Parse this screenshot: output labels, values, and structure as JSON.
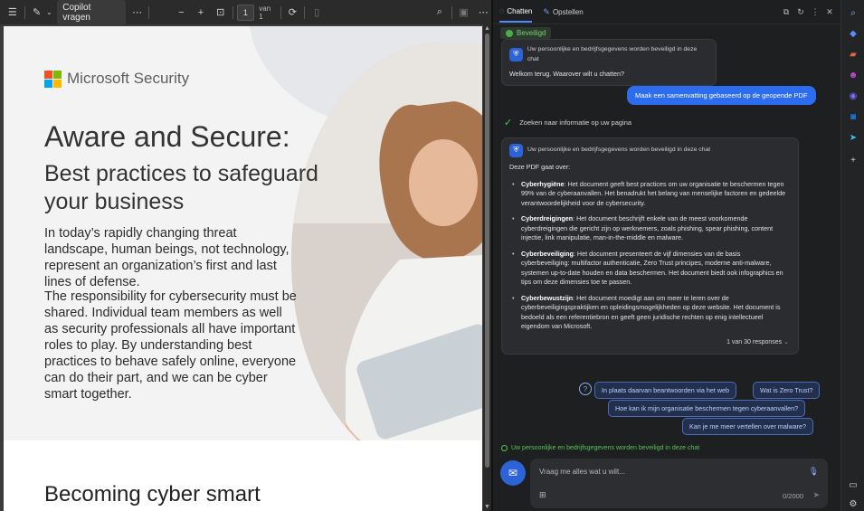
{
  "pdf_toolbar": {
    "copilot_label": "Copilot vragen",
    "page_value": "1",
    "page_of": "van 1",
    "icons": [
      "list-icon",
      "draw-icon",
      "chevron-down-icon",
      "more-icon",
      "zoom-out-icon",
      "zoom-in-icon",
      "fit-page-icon",
      "rotate-icon",
      "two-page-icon",
      "search-icon",
      "save-icon",
      "more-icon"
    ]
  },
  "pdf_page": {
    "logo_text": "Microsoft Security",
    "logo_colors": [
      "#f25022",
      "#7fba00",
      "#00a4ef",
      "#ffb900"
    ],
    "title": "Aware and Secure:",
    "subtitle": "Best practices to safeguard your business",
    "paragraph1": "In today’s rapidly changing threat landscape, human beings, not technology, represent an organization’s first and last lines of defense.",
    "paragraph2": "The responsibility for cybersecurity must be shared. Individual team members as well as security professionals all have important roles to play. By understanding best practices to behave safely online, everyone can do their part, and we can be cyber smart together.",
    "section_heading": "Becoming cyber smart"
  },
  "copilot": {
    "tabs": [
      {
        "label": "Chatten",
        "icon": "chat-icon",
        "active": true
      },
      {
        "label": "Opstellen",
        "icon": "compose-icon",
        "active": false
      }
    ],
    "header_icons": [
      "open-new-icon",
      "refresh-icon",
      "more-icon",
      "close-icon"
    ],
    "protected_badge": "Beveiligd",
    "welcome_badge": "Uw persoonlijke en bedrijfsgegevens worden beveiligd in deze chat",
    "welcome_text": "Welkom terug. Waarover wilt u chatten?",
    "user_message": "Maak een samenvatting gebaseerd op de geopende PDF",
    "searching_text": "Zoeken naar informatie op uw pagina",
    "answer_badge": "Uw persoonlijke en bedrijfsgegevens worden beveiligd in deze chat",
    "answer_intro": "Deze PDF gaat over:",
    "answer_items": [
      {
        "term": "Cyberhygiëne",
        "text": ": Het document geeft best practices om uw organisatie te beschermen tegen 99% van de cyberaanvallen. Het benadrukt het belang van menselijke factoren en gedeelde verantwoordelijkheid voor de cybersecurity."
      },
      {
        "term": "Cyberdreigingen",
        "text": ": Het document beschrijft enkele van de meest voorkomende cyberdreigingen die gericht zijn op werknemers, zoals phishing, spear phishing, content injectie, link manipulatie, man-in-the-middle en malware."
      },
      {
        "term": "Cyberbeveiliging",
        "text": ": Het document presenteert de vijf dimensies van de basis cyberbeveiliging: multifactor authenticatie, Zero Trust principes, moderne anti-malware, systemen up-to-date houden en data beschermen. Het document biedt ook infographics en tips om deze dimensies toe te passen."
      },
      {
        "term": "Cyberbewustzijn",
        "text": ": Het document moedigt aan om meer te leren over de cyberbeveiligingspraktijken en opleidingsmogelijkheden op deze website. Het document is bedoeld als een referentiebron en geeft geen juridische rechten op enig intellectueel eigendom van Microsoft."
      }
    ],
    "response_count": "1 van 30 responses",
    "suggestions": [
      "In plaats daarvan beantwoorden via het web",
      "Wat is Zero Trust?",
      "Hoe kan ik mijn organisatie beschermen tegen cyberaanvallen?",
      "Kan je me meer vertellen over malware?"
    ],
    "privacy_note": "Uw persoonlijke en bedrijfsgegevens worden beveiligd in deze chat",
    "input_placeholder": "Vraag me alles wat u wilt...",
    "char_count": "0/2000"
  },
  "sidebar": {
    "icons": [
      {
        "name": "search-icon",
        "color": "#8ab4ff"
      },
      {
        "name": "tag-icon",
        "color": "#5b8cff"
      },
      {
        "name": "toolbox-icon",
        "color": "#e06a3c"
      },
      {
        "name": "people-icon",
        "color": "#c24bd0"
      },
      {
        "name": "copilot-icon",
        "color": "#7a6cff"
      },
      {
        "name": "outlook-icon",
        "color": "#1a7ae6"
      },
      {
        "name": "send-icon",
        "color": "#35c0e8"
      },
      {
        "name": "add-icon",
        "color": "#cfcfcf"
      },
      {
        "name": "sidebar-toggle-icon",
        "color": "#cfcfcf"
      },
      {
        "name": "settings-icon",
        "color": "#cfcfcf"
      }
    ]
  }
}
